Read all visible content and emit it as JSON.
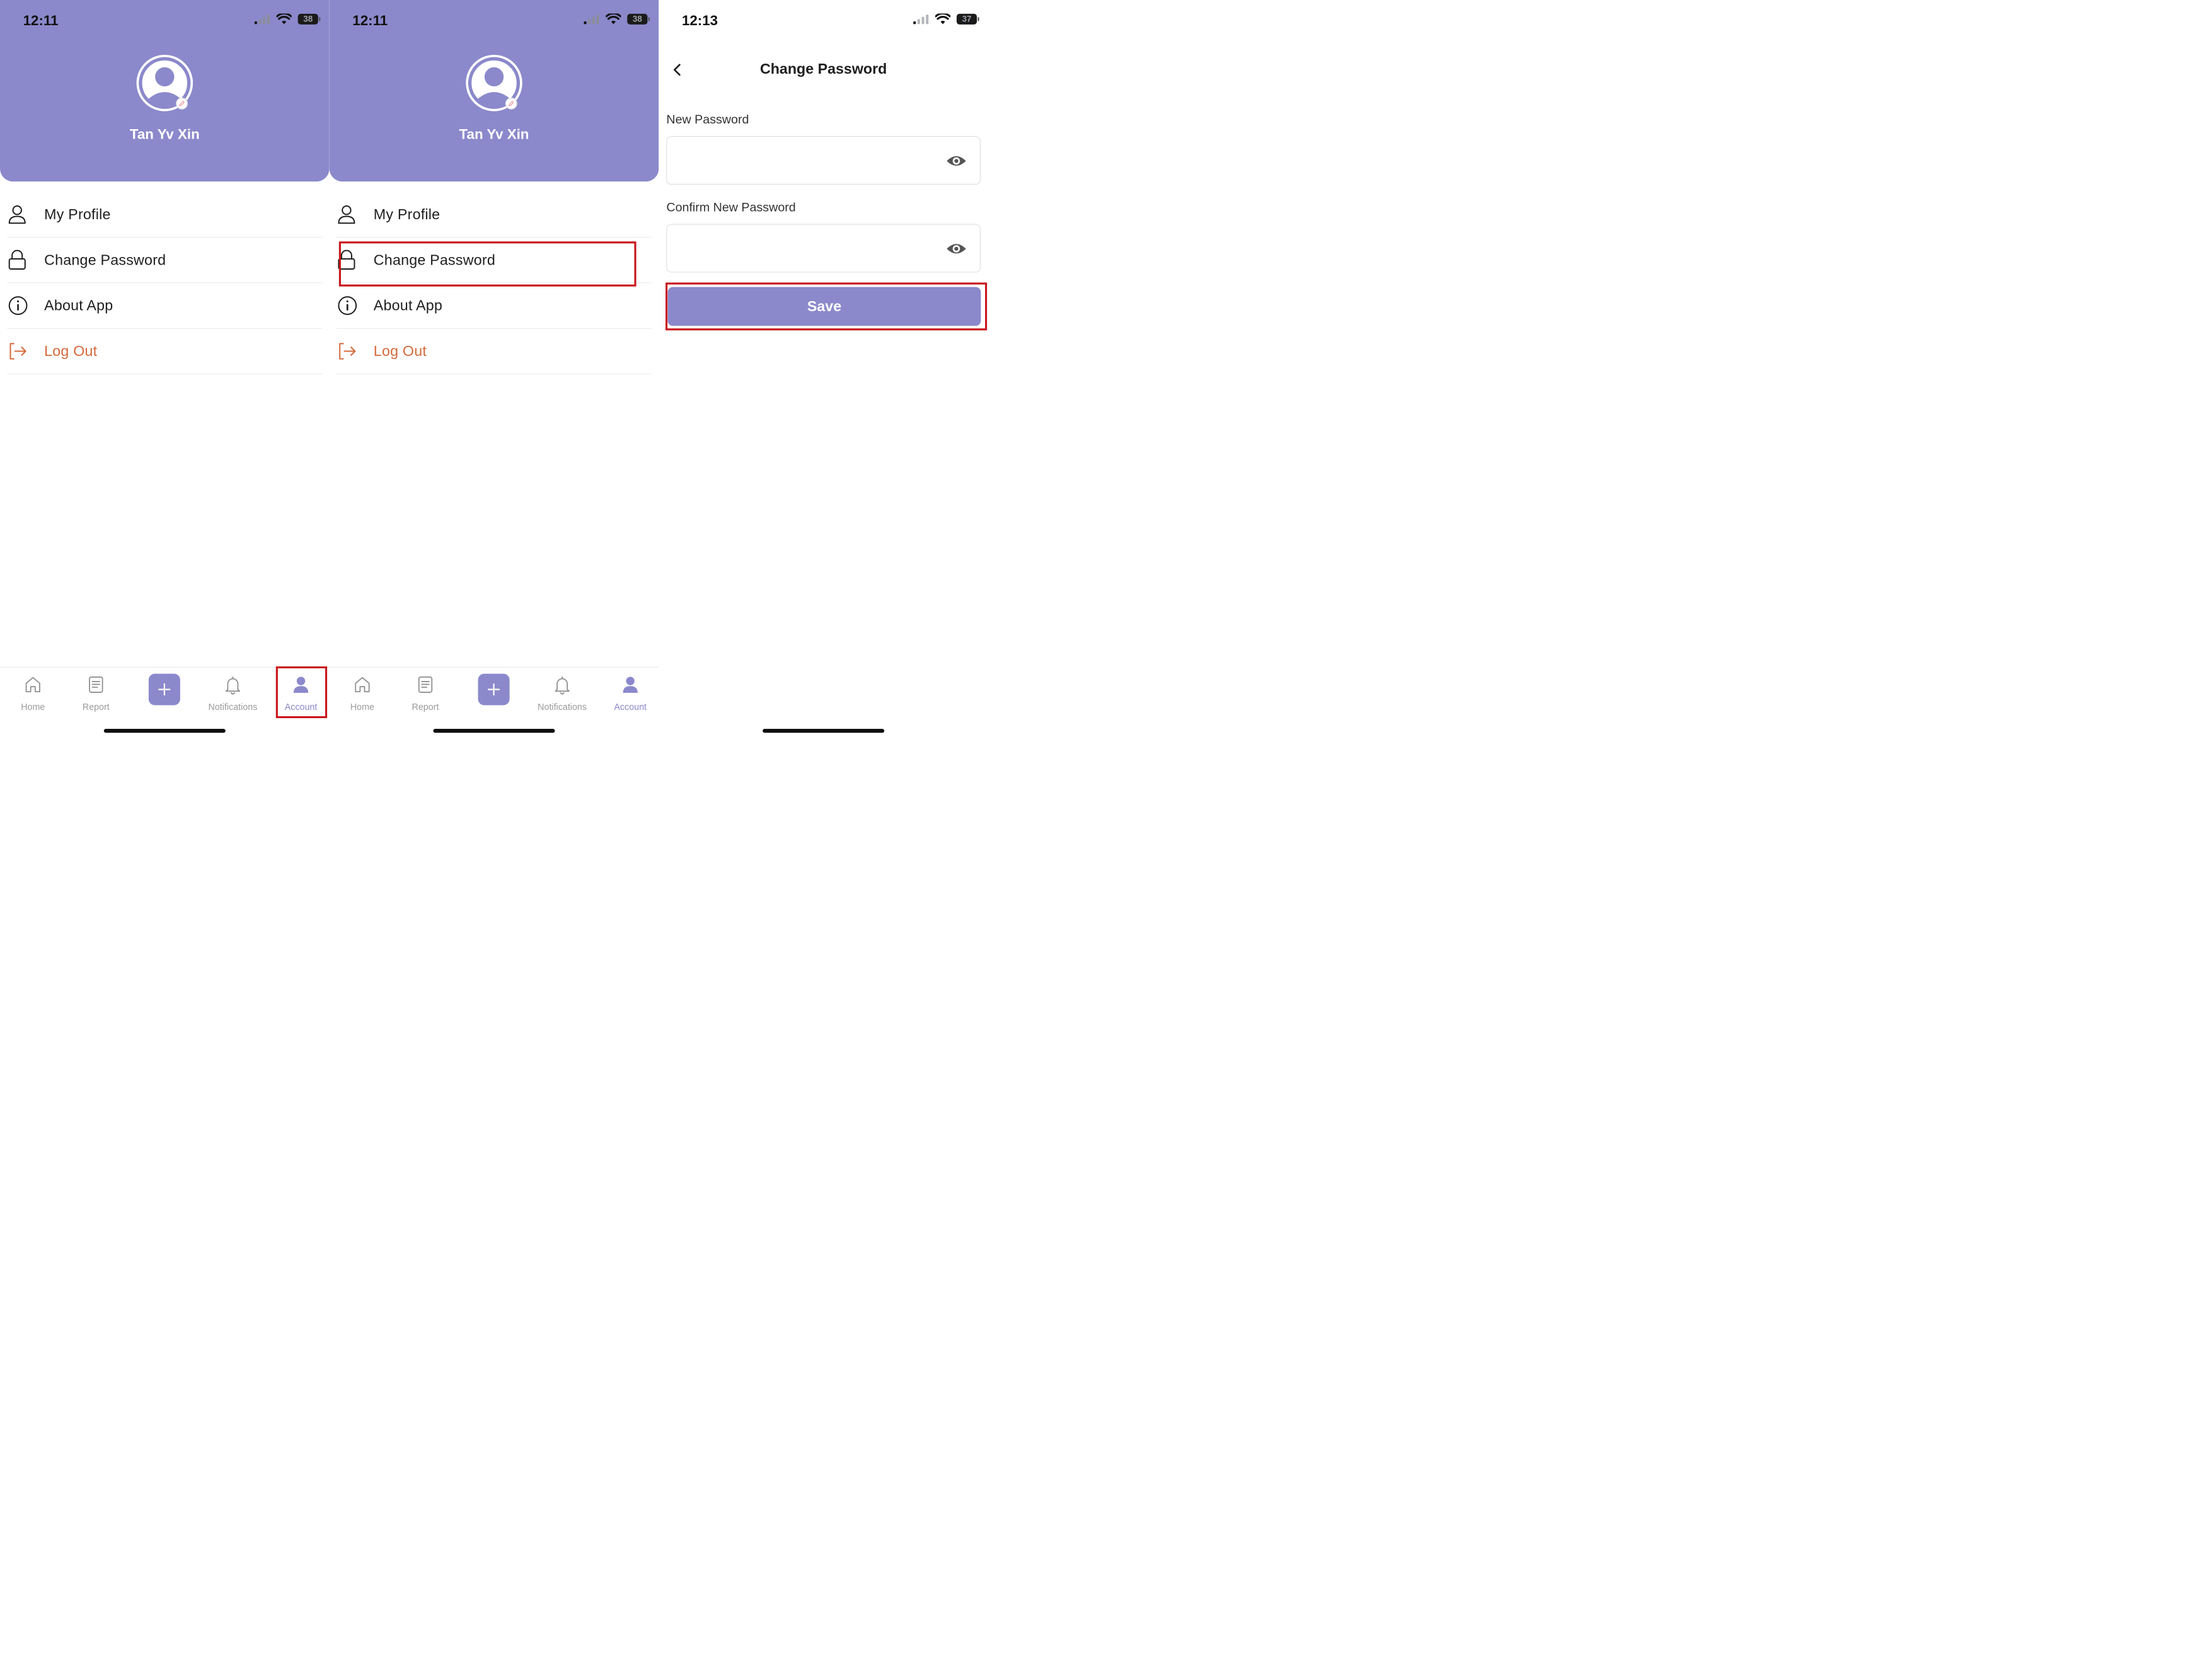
{
  "colors": {
    "accent": "#8b89cb",
    "highlight": "#c7161c",
    "logout": "#d4693a"
  },
  "screens": [
    {
      "status": {
        "time": "12:11",
        "battery": "38"
      },
      "profile": {
        "name": "Tan Yv Xin"
      },
      "menu": [
        {
          "label": "My Profile",
          "icon": "person-icon"
        },
        {
          "label": "Change Password",
          "icon": "lock-icon"
        },
        {
          "label": "About App",
          "icon": "info-icon"
        },
        {
          "label": "Log Out",
          "icon": "logout-icon"
        }
      ],
      "tabs": [
        {
          "label": "Home",
          "icon": "home-icon"
        },
        {
          "label": "Report",
          "icon": "document-icon"
        },
        {
          "label": "",
          "icon": "plus-icon"
        },
        {
          "label": "Notifications",
          "icon": "bell-icon"
        },
        {
          "label": "Account",
          "icon": "account-icon",
          "active": true
        }
      ]
    },
    {
      "status": {
        "time": "12:11",
        "battery": "38"
      },
      "profile": {
        "name": "Tan Yv Xin"
      },
      "menu": [
        {
          "label": "My Profile",
          "icon": "person-icon"
        },
        {
          "label": "Change Password",
          "icon": "lock-icon"
        },
        {
          "label": "About App",
          "icon": "info-icon"
        },
        {
          "label": "Log Out",
          "icon": "logout-icon"
        }
      ],
      "tabs": [
        {
          "label": "Home",
          "icon": "home-icon"
        },
        {
          "label": "Report",
          "icon": "document-icon"
        },
        {
          "label": "",
          "icon": "plus-icon"
        },
        {
          "label": "Notifications",
          "icon": "bell-icon"
        },
        {
          "label": "Account",
          "icon": "account-icon",
          "active": true
        }
      ]
    },
    {
      "status": {
        "time": "12:13",
        "battery": "37"
      },
      "title": "Change Password",
      "fields": [
        {
          "label": "New Password",
          "value": ""
        },
        {
          "label": "Confirm New Password",
          "value": ""
        }
      ],
      "save_label": "Save"
    }
  ]
}
